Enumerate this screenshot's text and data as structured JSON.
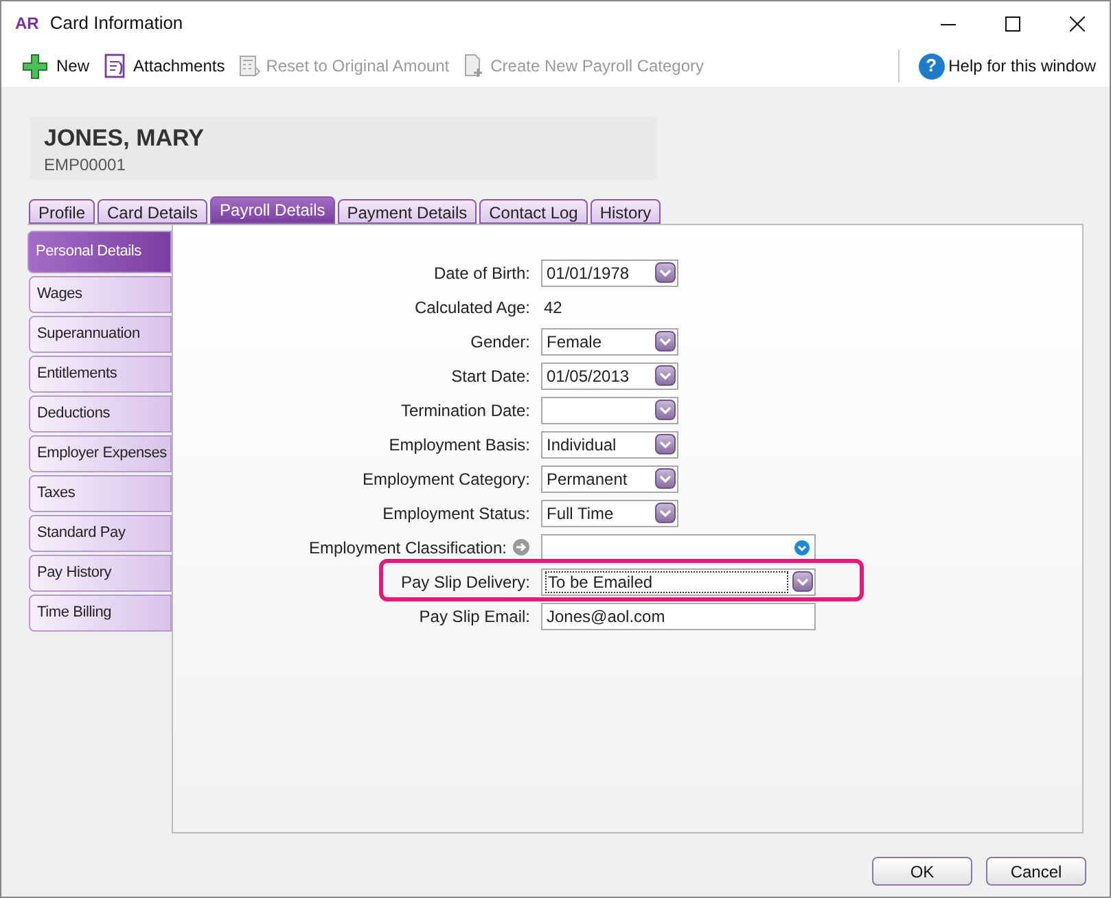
{
  "window": {
    "logo": "AR",
    "title": "Card Information"
  },
  "toolbar": [
    {
      "label": "New",
      "kind": "new",
      "disabled": false
    },
    {
      "label": "Attachments",
      "kind": "attach",
      "disabled": false
    },
    {
      "label": "Reset to Original Amount",
      "kind": "reset",
      "disabled": true
    },
    {
      "label": "Create New Payroll Category",
      "kind": "create",
      "disabled": true
    }
  ],
  "help": {
    "label": "Help for this window",
    "icon": "?"
  },
  "header": {
    "name": "JONES, MARY",
    "id": "EMP00001"
  },
  "tabs": [
    {
      "label": "Profile",
      "selected": false
    },
    {
      "label": "Card Details",
      "selected": false
    },
    {
      "label": "Payroll Details",
      "selected": true
    },
    {
      "label": "Payment Details",
      "selected": false
    },
    {
      "label": "Contact Log",
      "selected": false
    },
    {
      "label": "History",
      "selected": false
    }
  ],
  "side_tabs": [
    {
      "label": "Personal Details",
      "selected": true
    },
    {
      "label": "Wages",
      "selected": false
    },
    {
      "label": "Superannuation",
      "selected": false
    },
    {
      "label": "Entitlements",
      "selected": false
    },
    {
      "label": "Deductions",
      "selected": false
    },
    {
      "label": "Employer Expenses",
      "selected": false
    },
    {
      "label": "Taxes",
      "selected": false
    },
    {
      "label": "Standard Pay",
      "selected": false
    },
    {
      "label": "Pay History",
      "selected": false
    },
    {
      "label": "Time Billing",
      "selected": false
    }
  ],
  "fields": [
    {
      "label": "Date of Birth:",
      "kind": "select",
      "value": "01/01/1978",
      "highlighted": false
    },
    {
      "label": "Calculated Age:",
      "kind": "text",
      "value": "42",
      "highlighted": false
    },
    {
      "label": "Gender:",
      "kind": "select",
      "value": "Female",
      "highlighted": false
    },
    {
      "label": "Start Date:",
      "kind": "select",
      "value": "01/05/2013",
      "highlighted": false
    },
    {
      "label": "Termination Date:",
      "kind": "select",
      "highlighted": false
    },
    {
      "label": "Employment Basis:",
      "kind": "select",
      "value": "Individual",
      "highlighted": false
    },
    {
      "label": "Employment Category:",
      "kind": "select",
      "value": "Permanent",
      "highlighted": false
    },
    {
      "label": "Employment Status:",
      "kind": "select",
      "value": "Full Time",
      "highlighted": false
    },
    {
      "label": "Employment Classification:",
      "kind": "lookup",
      "highlighted": false
    },
    {
      "label": "Pay Slip Delivery:",
      "kind": "wide-select",
      "value": "To be Emailed",
      "highlighted": true
    },
    {
      "label": "Pay Slip Email:",
      "kind": "input",
      "value": "Jones@aol.com",
      "highlighted": false
    }
  ],
  "buttons": [
    "OK",
    "Cancel"
  ]
}
